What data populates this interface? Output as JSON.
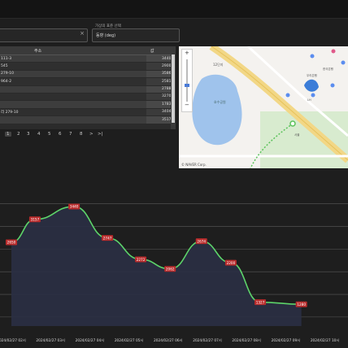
{
  "search": {
    "clear_icon": "×"
  },
  "selector": {
    "label": "가상의 표준 선택",
    "value": "동향 (deg)"
  },
  "table": {
    "columns": [
      "주소",
      "값"
    ],
    "rows": [
      {
        "addr": "111-3",
        "val": "3440"
      },
      {
        "addr": "545",
        "val": "2900"
      },
      {
        "addr": "279-10",
        "val": "3586"
      },
      {
        "addr": "964-2",
        "val": "2581"
      },
      {
        "addr": "",
        "val": "2788"
      },
      {
        "addr": "",
        "val": "3270"
      },
      {
        "addr": "",
        "val": "1783"
      },
      {
        "addr": "리 279-10",
        "val": "3404"
      },
      {
        "addr": "",
        "val": "3517"
      }
    ]
  },
  "pager": {
    "pages": [
      "1",
      "2",
      "3",
      "4",
      "5",
      "6",
      "7",
      "8"
    ],
    "next": ">",
    "last": ">|",
    "current": "1"
  },
  "map": {
    "credit": "© NAVER Corp.",
    "zoom_in": "+",
    "zoom_out": "−",
    "labels": [
      {
        "text": "12단지",
        "kind": "place"
      },
      {
        "text": "호수공원",
        "kind": "park"
      },
      {
        "text": "우리은행",
        "kind": "place"
      },
      {
        "text": "한국은행",
        "kind": "place"
      },
      {
        "text": "LH",
        "kind": "place"
      },
      {
        "text": "서울",
        "kind": "place"
      }
    ],
    "colors": {
      "water": "#9fc3ec",
      "road": "#f2d786",
      "park": "#d8ebcf",
      "route": "#5ac25a"
    }
  },
  "chart_data": {
    "type": "line",
    "x": [
      "2024/02/27 02시",
      "2024/02/27 03시",
      "2024/02/27 04시",
      "2024/02/27 05시",
      "2024/02/27 06시",
      "2024/02/27 07시",
      "2024/02/27 08시",
      "2024/02/27 09시",
      "2024/02/27 10시",
      "2024/02/27 11시"
    ],
    "points": [
      {
        "x": 0.0,
        "y": 2650
      },
      {
        "x": 0.6,
        "y": 3157
      },
      {
        "x": 1.6,
        "y": 3440
      },
      {
        "x": 2.45,
        "y": 2747
      },
      {
        "x": 3.3,
        "y": 2272
      },
      {
        "x": 4.05,
        "y": 2062
      },
      {
        "x": 4.85,
        "y": 2674
      },
      {
        "x": 5.6,
        "y": 2200
      },
      {
        "x": 6.35,
        "y": 1327
      },
      {
        "x": 7.4,
        "y": 1280
      }
    ],
    "ylim": [
      800,
      3800
    ],
    "colors": {
      "line": "#5dd46a",
      "fill": "#2a2f44",
      "label_bg": "#b92c2c",
      "grid": "#5a5a5a"
    }
  }
}
